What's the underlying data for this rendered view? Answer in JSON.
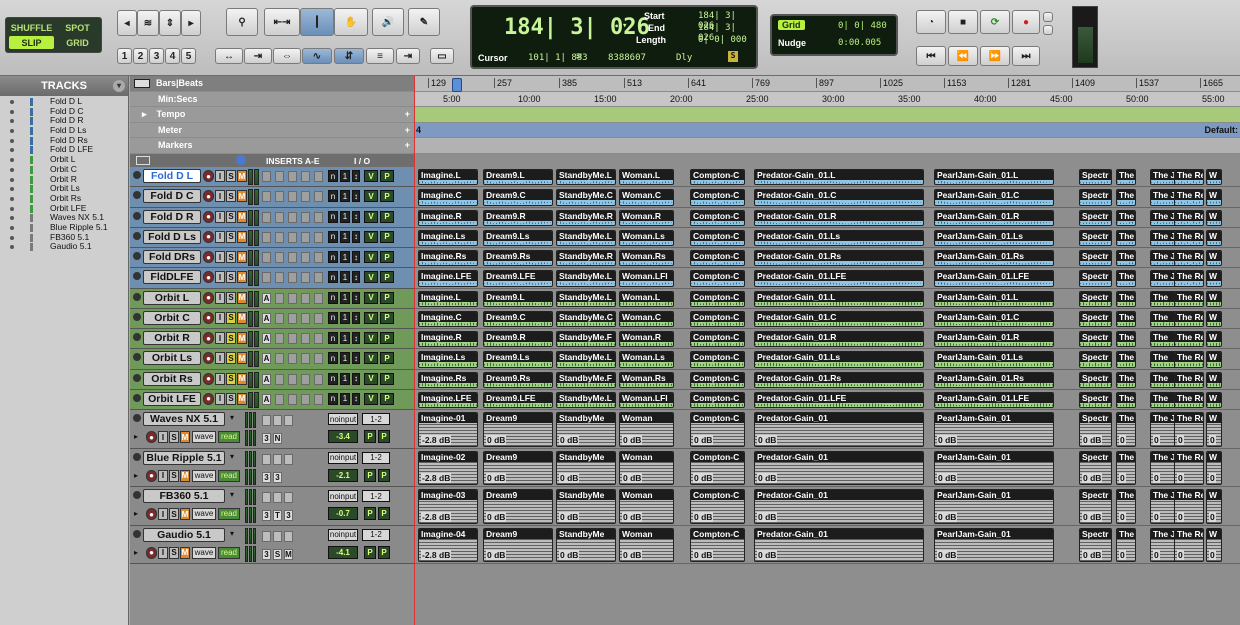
{
  "toolbar": {
    "modes": {
      "shuffle": "SHUFFLE",
      "spot": "SPOT",
      "slip": "SLIP",
      "grid": "GRID"
    },
    "numbers": [
      "1",
      "2",
      "3",
      "4",
      "5"
    ],
    "counter": {
      "main": "184| 3| 026",
      "start_label": "Start",
      "end_label": "End",
      "length_label": "Length",
      "start": "184| 3| 026",
      "end": "184| 3| 026",
      "length": "0| 0| 000",
      "cursor_label": "Cursor",
      "cursor": "101| 1| 883",
      "sample": "8388607",
      "dly": "Dly"
    },
    "grid": {
      "label": "Grid",
      "value": "0| 0| 480",
      "nudge_label": "Nudge",
      "nudge_value": "0:00.005"
    }
  },
  "tracks_panel": {
    "title": "TRACKS",
    "items": [
      "Fold D L",
      "Fold D C",
      "Fold D R",
      "Fold D Ls",
      "Fold D Rs",
      "Fold D LFE",
      "Orbit L",
      "Orbit C",
      "Orbit R",
      "Orbit Ls",
      "Orbit Rs",
      "Orbit LFE",
      "Waves NX 5.1",
      "Blue Ripple 5.1",
      "FB360 5.1",
      "Gaudio 5.1"
    ]
  },
  "rulers": {
    "bars": {
      "label": "Bars|Beats",
      "ticks": [
        "129",
        "257",
        "385",
        "513",
        "641",
        "769",
        "897",
        "1025",
        "1153",
        "1281",
        "1409",
        "1537",
        "1665"
      ]
    },
    "minsecs": {
      "label": "Min:Secs",
      "ticks": [
        "5:00",
        "10:00",
        "15:00",
        "20:00",
        "25:00",
        "30:00",
        "35:00",
        "40:00",
        "45:00",
        "50:00",
        "55:00"
      ]
    },
    "tempo": {
      "label": "Tempo"
    },
    "meter": {
      "label": "Meter",
      "value": "4",
      "default": "Default:"
    },
    "markers": {
      "label": "Markers"
    }
  },
  "mix_header": {
    "inserts": "INSERTS A-E",
    "io": "I / O"
  },
  "tracks": [
    {
      "name": "Fold D L",
      "color": "blue",
      "selected": true
    },
    {
      "name": "Fold D C",
      "color": "blue"
    },
    {
      "name": "Fold D R",
      "color": "blue"
    },
    {
      "name": "Fold D Ls",
      "color": "blue"
    },
    {
      "name": "Fold DRs",
      "color": "blue"
    },
    {
      "name": "FldDLFE",
      "color": "blue"
    },
    {
      "name": "Orbit L",
      "color": "green",
      "insert": "A"
    },
    {
      "name": "Orbit C",
      "color": "green",
      "insert": "A"
    },
    {
      "name": "Orbit R",
      "color": "green",
      "insert": "A"
    },
    {
      "name": "Orbit Ls",
      "color": "green",
      "insert": "A"
    },
    {
      "name": "Orbit Rs",
      "color": "green",
      "insert": "A"
    },
    {
      "name": "Orbit LFE",
      "color": "green",
      "insert": "A"
    }
  ],
  "aux_tracks": [
    {
      "name": "Waves NX 5.1",
      "vol": "-3.4",
      "ins": [
        "3",
        "N"
      ],
      "input": "noinput",
      "out": "1-2"
    },
    {
      "name": "Blue Ripple 5.1",
      "vol": "-2.1",
      "ins": [
        "3",
        "3"
      ],
      "input": "noinput",
      "out": "1-2"
    },
    {
      "name": "FB360 5.1",
      "vol": "-0.7",
      "ins": [
        "3",
        "T",
        "3"
      ],
      "input": "noinput",
      "out": "1-2"
    },
    {
      "name": "Gaudio 5.1",
      "vol": "-4.1",
      "ins": [
        "3",
        "S",
        "M"
      ],
      "input": "noinput",
      "out": "1-2"
    }
  ],
  "aux_buttons": {
    "wave": "wave",
    "read": "read"
  },
  "clip_rows": [
    [
      "Imagine.L",
      "Dream9.L",
      "StandbyMe.L",
      "Woman.L",
      "Compton-C",
      "Predator-Gain_01.L",
      "PearlJam-Gain_01.L",
      "Spectr",
      "The",
      "The Ju",
      "The Re",
      "W"
    ],
    [
      "Imagine.C",
      "Dream9.C",
      "StandbyMe.C",
      "Woman.C",
      "Compton-C",
      "Predator-Gain_01.C",
      "PearlJam-Gain_01.C",
      "Spectr",
      "The",
      "The Ju",
      "The Re",
      "W"
    ],
    [
      "Imagine.R",
      "Dream9.R",
      "StandbyMe.R",
      "Woman.R",
      "Compton-C",
      "Predator-Gain_01.R",
      "PearlJam-Gain_01.R",
      "Spectr",
      "The",
      "The Ju",
      "The Re",
      "W"
    ],
    [
      "Imagine.Ls",
      "Dream9.Ls",
      "StandbyMe.L",
      "Woman.Ls",
      "Compton-C",
      "Predator-Gain_01.Ls",
      "PearlJam-Gain_01.Ls",
      "Spectr",
      "The",
      "The Ju",
      "The Re",
      "W"
    ],
    [
      "Imagine.Rs",
      "Dream9.Rs",
      "StandbyMe.R",
      "Woman.Rs",
      "Compton-C",
      "Predator-Gain_01.Rs",
      "PearlJam-Gain_01.Rs",
      "Spectr",
      "The",
      "The Ju",
      "The Re",
      "W"
    ],
    [
      "Imagine.LFE",
      "Dream9.LFE",
      "StandbyMe.L",
      "Woman.LFI",
      "Compton-C",
      "Predator-Gain_01.LFE",
      "PearlJam-Gain_01.LFE",
      "Spectr",
      "The",
      "The Ju",
      "The Re",
      "W"
    ],
    [
      "Imagine.L",
      "Dream9.L",
      "StandbyMe.L",
      "Woman.L",
      "Compton-C",
      "Predator-Gain_01.L",
      "PearlJam-Gain_01.L",
      "Spectr",
      "The",
      "The",
      "The Re",
      "W"
    ],
    [
      "Imagine.C",
      "Dream9.C",
      "StandbyMe.C",
      "Woman.C",
      "Compton-C",
      "Predator-Gain_01.C",
      "PearlJam-Gain_01.C",
      "Spectr",
      "The",
      "The",
      "The Re",
      "W"
    ],
    [
      "Imagine.R",
      "Dream9.R",
      "StandbyMe.F",
      "Woman.R",
      "Compton-C",
      "Predator-Gain_01.R",
      "PearlJam-Gain_01.R",
      "Spectr",
      "The",
      "The",
      "The Re",
      "W"
    ],
    [
      "Imagine.Ls",
      "Dream9.Ls",
      "StandbyMe.L",
      "Woman.Ls",
      "Compton-C",
      "Predator-Gain_01.Ls",
      "PearlJam-Gain_01.Ls",
      "Spectr",
      "The",
      "The",
      "The Re",
      "W"
    ],
    [
      "Imagine.Rs",
      "Dream9.Rs",
      "StandbyMe.F",
      "Woman.Rs",
      "Compton-C",
      "Predator-Gain_01.Rs",
      "PearlJam-Gain_01.Rs",
      "Spectr",
      "The",
      "The",
      "The Re",
      "W"
    ],
    [
      "Imagine.LFE",
      "Dream9.LFE",
      "StandbyMe.L",
      "Woman.LFI",
      "Compton-C",
      "Predator-Gain_01.LFE",
      "PearlJam-Gain_01.LFE",
      "Spectr",
      "The",
      "The",
      "The Re",
      "W"
    ]
  ],
  "aux_clip_rows": [
    [
      "Imagine-01",
      "Dream9",
      "StandbyMe",
      "Woman",
      "Compton-C",
      "Predator-Gain_01",
      "PearlJam-Gain_01",
      "Spectr",
      "The",
      "The Ju",
      "The Re",
      "W"
    ],
    [
      "Imagine-02",
      "Dream9",
      "StandbyMe",
      "Woman",
      "Compton-C",
      "Predator-Gain_01",
      "PearlJam-Gain_01",
      "Spectr",
      "The",
      "The Ju",
      "The Re",
      "W"
    ],
    [
      "Imagine-03",
      "Dream9",
      "StandbyMe",
      "Woman",
      "Compton-C",
      "Predator-Gain_01",
      "PearlJam-Gain_01",
      "Spectr",
      "The",
      "The Ju",
      "The Re",
      "W"
    ],
    [
      "Imagine-04",
      "Dream9",
      "StandbyMe",
      "Woman",
      "Compton-C",
      "Predator-Gain_01",
      "PearlJam-Gain_01",
      "Spectr",
      "The",
      "The Ju",
      "The Re",
      "W"
    ]
  ],
  "aux_gain": [
    [
      "-2.8 dB",
      "0 dB",
      "0 dB",
      "0 dB",
      "0 dB",
      "0 dB",
      "0 dB",
      "0 dB",
      "0",
      "0",
      "0",
      "0"
    ],
    [
      "-2.8 dB",
      "0 dB",
      "0 dB",
      "0 dB",
      "0 dB",
      "0 dB",
      "0 dB",
      "0 dB",
      "0",
      "0",
      "0",
      "0"
    ],
    [
      "-2.8 dB",
      "0 dB",
      "0 dB",
      "0 dB",
      "0 dB",
      "0 dB",
      "0 dB",
      "0 dB",
      "0",
      "0",
      "0",
      "0"
    ],
    [
      "-2.8 dB",
      "0 dB",
      "0 dB",
      "0 dB",
      "0 dB",
      "0 dB",
      "0 dB",
      "0 dB",
      "0",
      "0",
      "0",
      "0"
    ]
  ],
  "colors": {
    "blue_clip": "#8ec4e4",
    "green_clip": "#9fd486",
    "lcd_text": "#b6f07a",
    "playhead": "#dd3333"
  }
}
